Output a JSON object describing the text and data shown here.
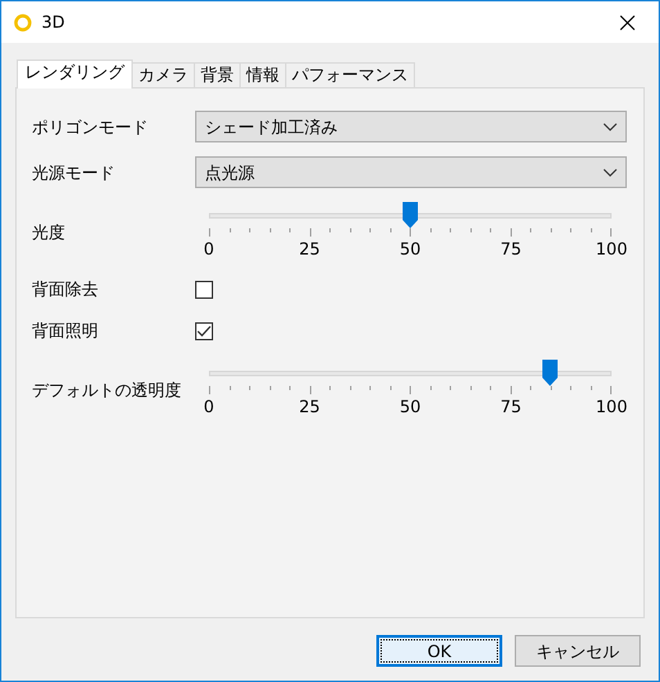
{
  "window": {
    "title": "3D"
  },
  "tabs": [
    {
      "label": "レンダリング",
      "selected": true
    },
    {
      "label": "カメラ",
      "selected": false
    },
    {
      "label": "背景",
      "selected": false
    },
    {
      "label": "情報",
      "selected": false
    },
    {
      "label": "パフォーマンス",
      "selected": false
    }
  ],
  "rows": [
    {
      "kind": "select",
      "label": "ポリゴンモード",
      "value": "シェード加工済み"
    },
    {
      "kind": "select",
      "label": "光源モード",
      "value": "点光源"
    },
    {
      "kind": "slider",
      "label": "光度",
      "level": 0.5,
      "tick_labels": [
        "0",
        "25",
        "50",
        "75",
        "100"
      ]
    },
    {
      "kind": "checkbox",
      "label": "背面除去",
      "checked": false
    },
    {
      "kind": "checkbox",
      "label": "背面照明",
      "checked": true
    },
    {
      "kind": "slider",
      "label": "デフォルトの透明度",
      "level": 0.85,
      "tick_labels": [
        "0",
        "25",
        "50",
        "75",
        "100"
      ]
    }
  ],
  "buttons": [
    {
      "label": "OK",
      "default": true
    },
    {
      "label": "キャンセル",
      "default": false
    }
  ]
}
